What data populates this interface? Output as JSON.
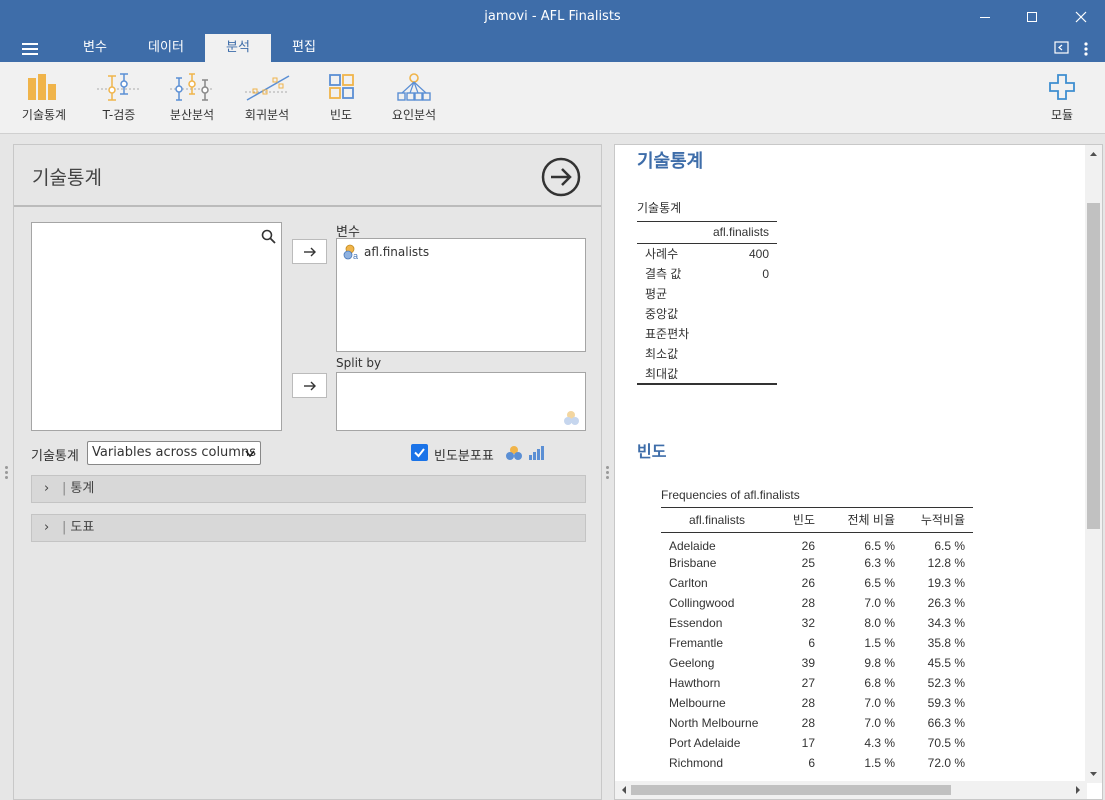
{
  "window": {
    "title": "jamovi - AFL Finalists"
  },
  "tabs": [
    "변수",
    "데이터",
    "분석",
    "편집"
  ],
  "ribbon": {
    "items": [
      "기술통계",
      "T-검증",
      "분산분석",
      "회귀분석",
      "빈도",
      "요인분석"
    ],
    "modules_label": "모듈"
  },
  "options": {
    "title": "기술통계",
    "variables_label": "변수",
    "variables": [
      "afl.finalists"
    ],
    "split_by_label": "Split by",
    "descriptives_label": "기술통계",
    "layout_value": "Variables across columns",
    "frequency_tables_label": "빈도분포표",
    "frequency_tables_checked": true,
    "sections": [
      "통계",
      "도표"
    ]
  },
  "results": {
    "desc_heading": "기술통계",
    "desc_table": {
      "caption": "기술통계",
      "column": "afl.finalists",
      "rows": [
        {
          "label": "사례수",
          "value": "400"
        },
        {
          "label": "결측 값",
          "value": "0"
        },
        {
          "label": "평균",
          "value": ""
        },
        {
          "label": "중앙값",
          "value": ""
        },
        {
          "label": "표준편차",
          "value": ""
        },
        {
          "label": "최소값",
          "value": ""
        },
        {
          "label": "최대값",
          "value": ""
        }
      ]
    },
    "freq_heading": "빈도",
    "freq_table": {
      "caption": "Frequencies of afl.finalists",
      "headers": [
        "afl.finalists",
        "빈도",
        "전체 비율",
        "누적비율"
      ],
      "rows": [
        [
          "Adelaide",
          "26",
          "6.5 %",
          "6.5 %"
        ],
        [
          "Brisbane",
          "25",
          "6.3 %",
          "12.8 %"
        ],
        [
          "Carlton",
          "26",
          "6.5 %",
          "19.3 %"
        ],
        [
          "Collingwood",
          "28",
          "7.0 %",
          "26.3 %"
        ],
        [
          "Essendon",
          "32",
          "8.0 %",
          "34.3 %"
        ],
        [
          "Fremantle",
          "6",
          "1.5 %",
          "35.8 %"
        ],
        [
          "Geelong",
          "39",
          "9.8 %",
          "45.5 %"
        ],
        [
          "Hawthorn",
          "27",
          "6.8 %",
          "52.3 %"
        ],
        [
          "Melbourne",
          "28",
          "7.0 %",
          "59.3 %"
        ],
        [
          "North Melbourne",
          "28",
          "7.0 %",
          "66.3 %"
        ],
        [
          "Port Adelaide",
          "17",
          "4.3 %",
          "70.5 %"
        ],
        [
          "Richmond",
          "6",
          "1.5 %",
          "72.0 %"
        ]
      ]
    }
  },
  "colors": {
    "brand": "#3e6da9",
    "accent_orange": "#f0b44a"
  }
}
